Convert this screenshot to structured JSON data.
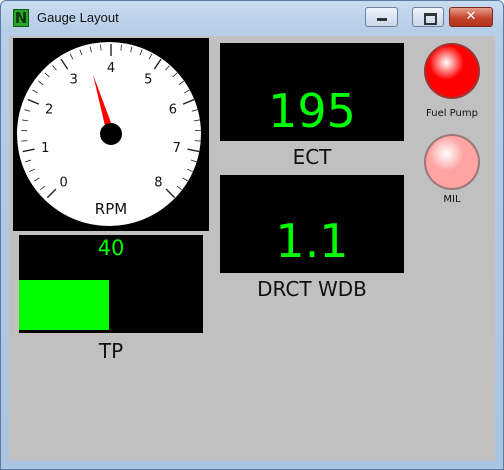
{
  "window": {
    "title": "Gauge Layout",
    "app_icon_letter": "N"
  },
  "gauge": {
    "label": "RPM",
    "ticks": [
      "0",
      "1",
      "2",
      "3",
      "4",
      "5",
      "6",
      "7",
      "8"
    ],
    "needle_value": 3.5,
    "min": 0,
    "max": 8
  },
  "ect": {
    "value": "195",
    "label": "ECT"
  },
  "drct_wdb": {
    "value": "1.1",
    "label": "DRCT WDB"
  },
  "tp": {
    "value": "40",
    "label": "TP",
    "bar_fraction": 0.49
  },
  "indicators": [
    {
      "label": "Fuel Pump",
      "color": "#ff0000",
      "state": "on"
    },
    {
      "label": "MIL",
      "color": "#ffa3a3",
      "state": "dim"
    }
  ],
  "colors": {
    "digital_text": "#00ff00",
    "panel_bg": "#000000",
    "client_bg": "#c0c0c0",
    "needle": "#ff0000"
  }
}
